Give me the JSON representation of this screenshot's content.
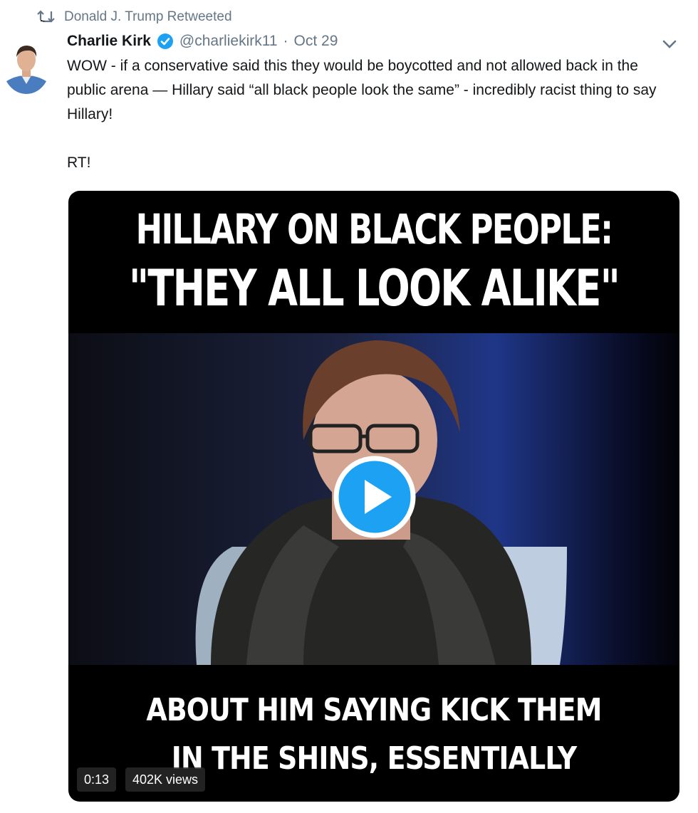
{
  "retweet": {
    "icon": "retweet-icon",
    "text": "Donald J. Trump Retweeted"
  },
  "tweet": {
    "author_name": "Charlie Kirk",
    "verified_icon": "verified-badge-icon",
    "handle": "@charliekirk11",
    "separator": "·",
    "date": "Oct 29",
    "menu_icon": "chevron-down-icon",
    "text_line": "WOW - if a conservative said this they would be boycotted and not allowed back in the public arena — Hillary said “all black people look the same” - incredibly racist thing to say Hillary!",
    "text_rt": "RT!"
  },
  "video": {
    "caption_top_line1": "HILLARY ON BLACK PEOPLE:",
    "caption_top_line2": "\"THEY ALL LOOK ALIKE\"",
    "caption_bottom_line1": "ABOUT HIM SAYING KICK THEM",
    "caption_bottom_line2": "IN THE SHINS, ESSENTIALLY",
    "play_icon": "play-icon",
    "duration": "0:13",
    "views": "402K views"
  },
  "colors": {
    "accent": "#1da1f2",
    "muted": "#657786",
    "text": "#14171a"
  }
}
